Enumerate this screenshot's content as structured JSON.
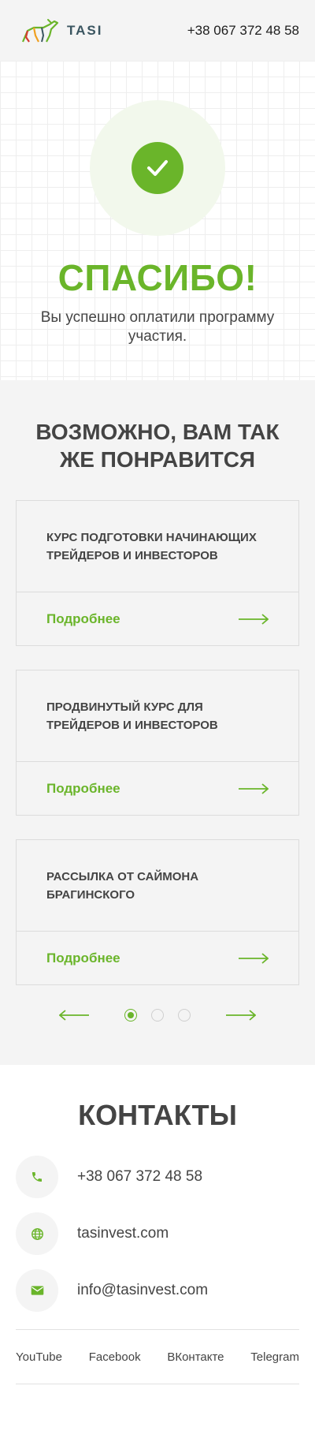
{
  "header": {
    "logo_text": "TASI",
    "phone": "+38 067 372 48 58"
  },
  "hero": {
    "title": "СПАСИБО!",
    "message": "Вы успешно оплатили программу участия."
  },
  "recommendations": {
    "title": "ВОЗМОЖНО, ВАМ ТАК ЖЕ ПОНРАВИТСЯ",
    "cards": [
      {
        "title": "КУРС ПОДГОТОВКИ НАЧИНАЮЩИХ ТРЕЙДЕРОВ И ИНВЕСТОРОВ",
        "link": "Подробнее"
      },
      {
        "title": "ПРОДВИНУТЫЙ КУРС ДЛЯ ТРЕЙДЕРОВ И ИНВЕСТОРОВ",
        "link": "Подробнее"
      },
      {
        "title": "РАССЫЛКА ОТ САЙМОНА БРАГИНСКОГО",
        "link": "Подробнее"
      }
    ],
    "slider": {
      "active_page": 1,
      "total_pages": 3
    }
  },
  "contacts": {
    "title": "КОНТАКТЫ",
    "items": [
      {
        "icon": "phone-icon",
        "text": "+38 067 372 48 58"
      },
      {
        "icon": "globe-icon",
        "text": "tasinvest.com"
      },
      {
        "icon": "mail-icon",
        "text": "info@tasinvest.com"
      }
    ]
  },
  "footer": {
    "links": [
      "YouTube",
      "Facebook",
      "ВКонтакте",
      "Telegram"
    ]
  },
  "colors": {
    "accent": "#6ab52a",
    "text": "#444444",
    "section_bg": "#f4f4f4"
  }
}
